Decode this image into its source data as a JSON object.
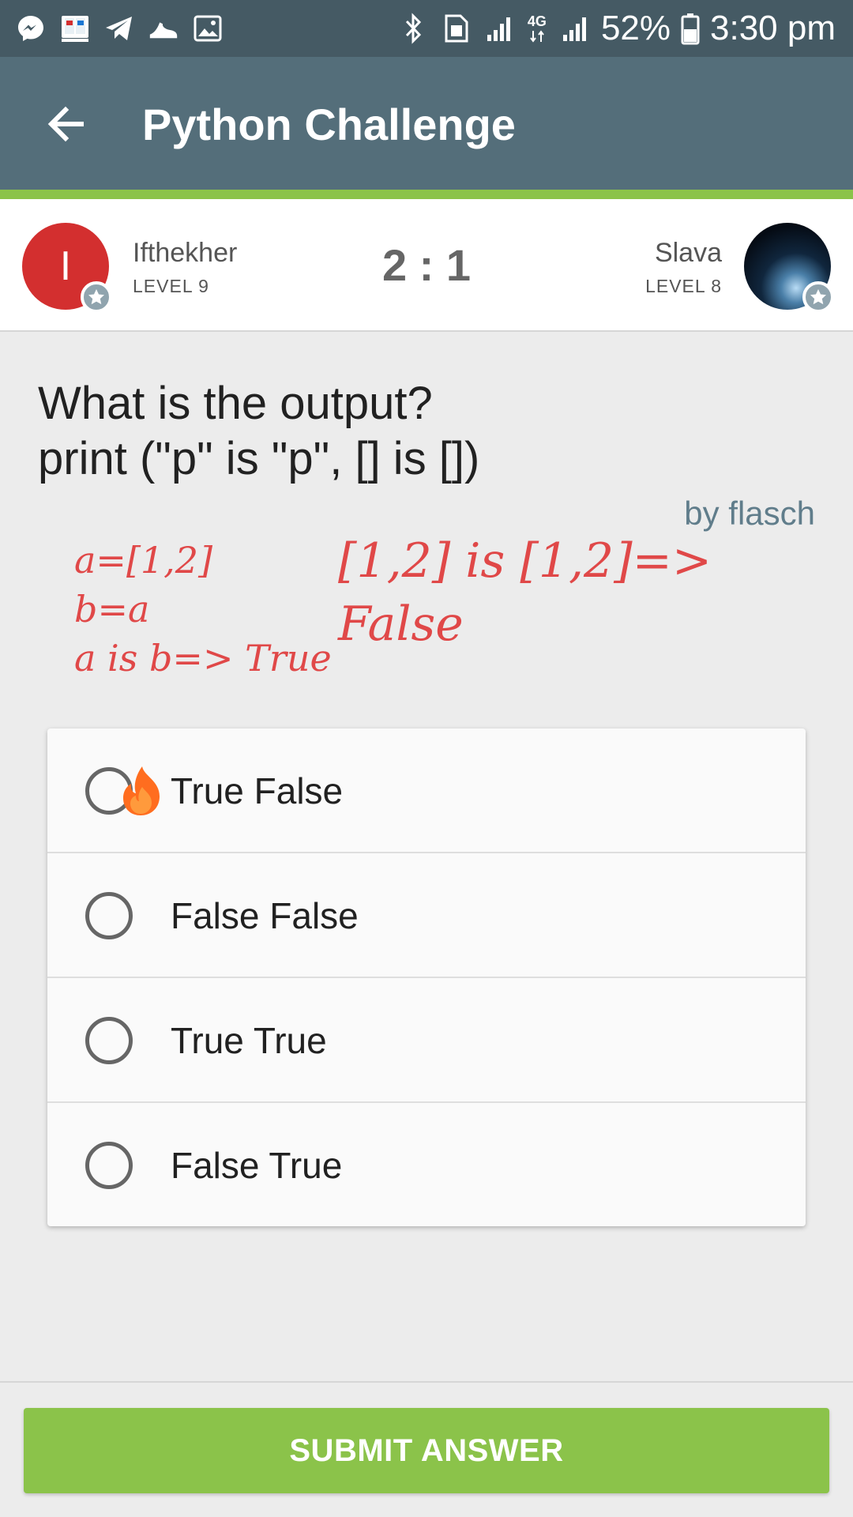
{
  "status_bar": {
    "battery": "52%",
    "time": "3:30 pm",
    "network": "4G",
    "left_icons": [
      "messenger-icon",
      "book-app-icon",
      "telegram-icon",
      "shoe-icon",
      "gallery-icon"
    ],
    "right_icons": [
      "bluetooth-icon",
      "sim-icon",
      "signal-icon",
      "4g-icon",
      "signal-icon",
      "battery-icon"
    ]
  },
  "app_bar": {
    "title": "Python Challenge",
    "back_icon": "arrow-left-icon",
    "progress": 1.0
  },
  "match": {
    "left_player": {
      "initial": "I",
      "name": "Ifthekher",
      "level": "LEVEL 9"
    },
    "score": "2 : 1",
    "right_player": {
      "name": "Slava",
      "level": "LEVEL 8"
    }
  },
  "question": {
    "line1": "What is the output?",
    "line2": "print (\"p\" is \"p\", [] is [])",
    "author": "by flasch"
  },
  "annotation": {
    "line1": "a=[1,2]",
    "line2": "b=a",
    "line3": "a is b=> True",
    "line4": "[1,2] is [1,2]=>",
    "line5": "False"
  },
  "options": [
    {
      "label": "True False"
    },
    {
      "label": "False False"
    },
    {
      "label": "True True"
    },
    {
      "label": "False True"
    }
  ],
  "submit": {
    "label": "SUBMIT ANSWER"
  },
  "colors": {
    "status_bar": "#455a64",
    "app_bar": "#546e7a",
    "accent": "#8bc34a",
    "annotation": "#e04848",
    "author": "#607d8b",
    "left_avatar": "#d32f2f"
  }
}
